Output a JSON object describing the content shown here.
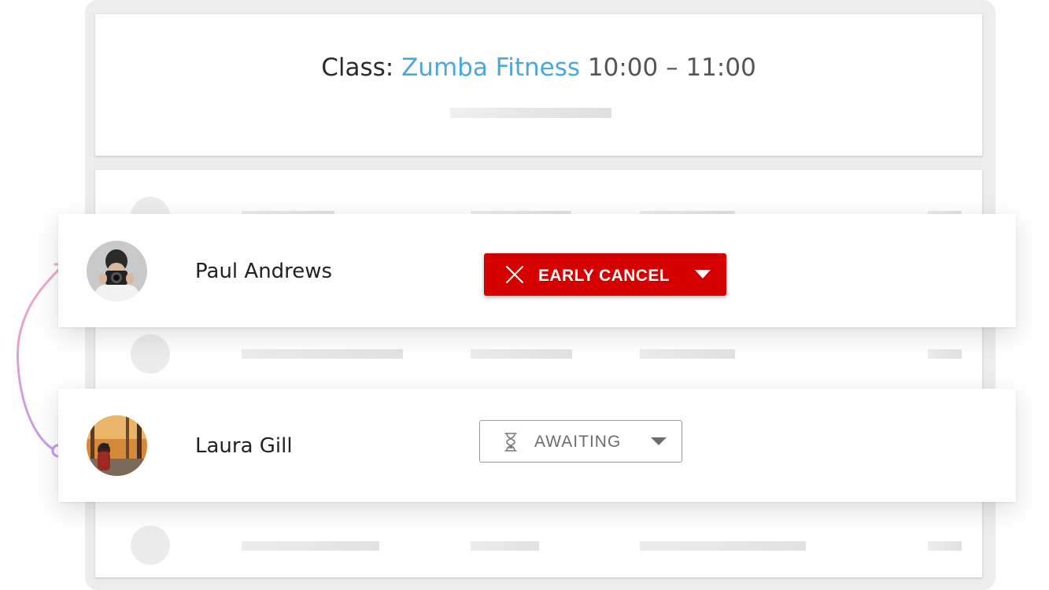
{
  "class_header": {
    "prefix": "Class:",
    "name": "Zumba Fitness",
    "time": "10:00 – 11:00"
  },
  "attendees": [
    {
      "name": "Paul Andrews",
      "status": {
        "label": "EARLY CANCEL",
        "icon": "x-icon",
        "color": "#d40000"
      }
    },
    {
      "name": "Laura Gill",
      "status": {
        "label": "AWAITING",
        "icon": "hourglass-icon",
        "color": "#6d6d6d"
      }
    }
  ],
  "colors": {
    "accent": "#4aa9d8",
    "cancel": "#d40000",
    "connector_start": "#c79be8",
    "connector_end": "#f7a6c4"
  }
}
